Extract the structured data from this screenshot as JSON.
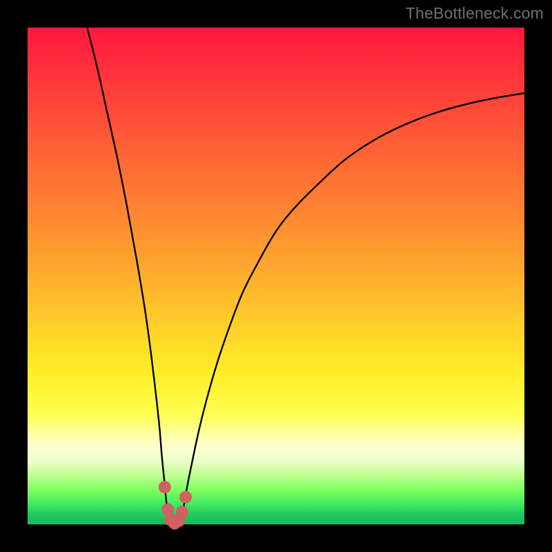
{
  "watermark": "TheBottleneck.com",
  "colors": {
    "page_bg": "#000000",
    "watermark": "#6f6f6f",
    "curve": "#000000",
    "marker_fill": "#d1605f",
    "marker_stroke": "#b84a49"
  },
  "chart_data": {
    "type": "line",
    "title": "",
    "xlabel": "",
    "ylabel": "",
    "xlim": [
      0,
      100
    ],
    "ylim": [
      0,
      100
    ],
    "grid": false,
    "legend": false,
    "series": [
      {
        "name": "curve",
        "x": [
          12,
          14,
          16,
          18,
          20,
          22,
          23.5,
          24.5,
          25.5,
          26.5,
          27,
          27.5,
          28,
          28.6,
          29.2,
          29.8,
          30.5,
          31.3,
          32,
          33,
          34.5,
          36,
          38,
          40,
          43,
          46,
          50,
          54,
          59,
          64,
          70,
          76,
          82,
          88,
          94,
          100
        ],
        "y": [
          100,
          92,
          83,
          74,
          64,
          53,
          44,
          37,
          29,
          20,
          14,
          9,
          4,
          1.2,
          0.3,
          0.3,
          1.0,
          3,
          7,
          12,
          19,
          25,
          32,
          38,
          46,
          52,
          59,
          64,
          69,
          73.5,
          77.5,
          80.5,
          82.8,
          84.5,
          85.8,
          86.8
        ]
      }
    ],
    "markers": {
      "name": "valley-markers",
      "x": [
        27.6,
        28.2,
        28.8,
        29.6,
        30.4,
        31.1,
        31.8
      ],
      "y": [
        7.5,
        3.0,
        0.9,
        0.2,
        0.7,
        2.5,
        5.5
      ]
    }
  }
}
